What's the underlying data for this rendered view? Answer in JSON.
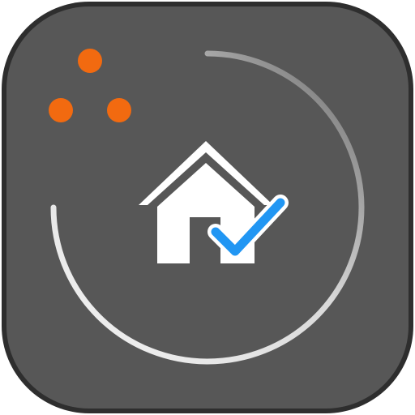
{
  "app_icon": {
    "name": "home-check-app-icon",
    "icons": [
      "rounded-square-background",
      "progress-ring",
      "orange-dots",
      "house-icon",
      "checkmark-icon"
    ],
    "colors": {
      "outer_border": "#2e2e2e",
      "background": "#575757",
      "ring_light": "#f4f4f4",
      "ring_dark": "#575757",
      "dot": "#f26a10",
      "house": "#ffffff",
      "check": "#2196f3",
      "check_outline": "#ffffff"
    }
  }
}
